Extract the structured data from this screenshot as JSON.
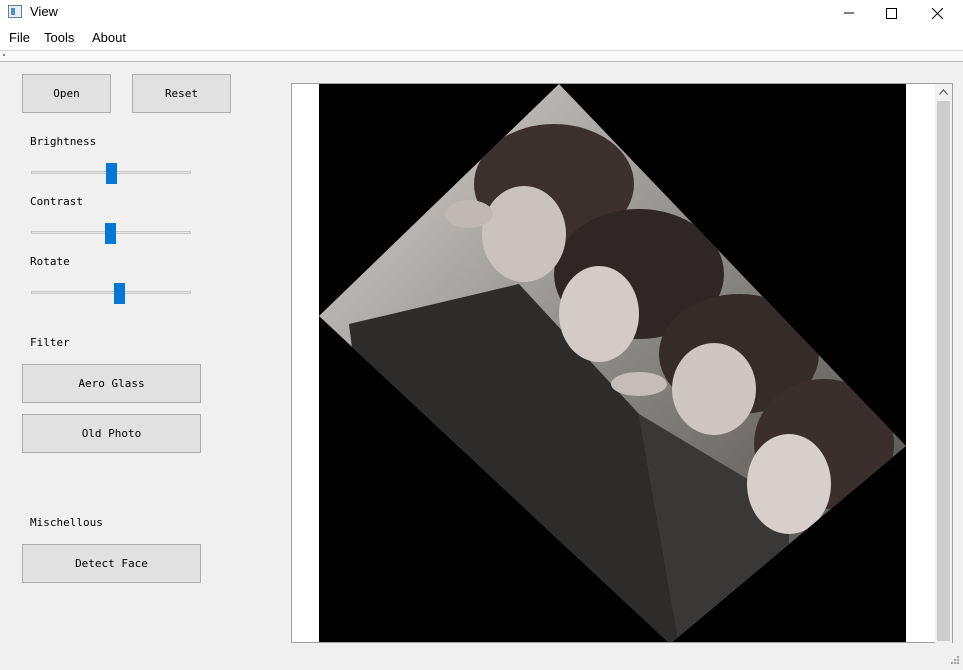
{
  "window": {
    "title": "View"
  },
  "menu": {
    "file": "File",
    "tools": "Tools",
    "about": "About"
  },
  "toolbar": {
    "open_label": "Open",
    "reset_label": "Reset"
  },
  "adjustments": {
    "brightness_label": "Brightness",
    "brightness_value": 0.5,
    "contrast_label": "Contrast",
    "contrast_value": 0.5,
    "rotate_label": "Rotate",
    "rotate_value": 0.56
  },
  "filter": {
    "heading": "Filter",
    "aero_glass_label": "Aero Glass",
    "old_photo_label": "Old Photo"
  },
  "misc": {
    "heading": "Mischellous",
    "detect_face_label": "Detect Face"
  },
  "colors": {
    "accent": "#0078d7",
    "image_background": "#000000"
  },
  "icons": {
    "app": "window-icon",
    "minimize": "minimize-icon",
    "maximize": "maximize-icon",
    "close": "close-icon",
    "scroll_up": "chevron-up-icon",
    "size_grip": "size-grip-icon"
  }
}
